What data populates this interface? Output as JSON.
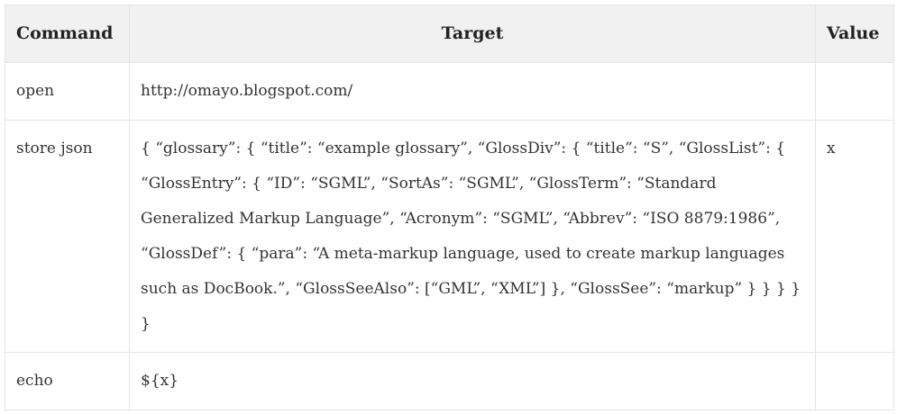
{
  "table": {
    "headers": [
      "Command",
      "Target",
      "Value"
    ],
    "rows": [
      {
        "command": "open",
        "target": "http://omayo.blogspot.com/",
        "value": ""
      },
      {
        "command": "store json",
        "target": "{ “glossary”: { “title”: “example glossary”, “GlossDiv”: { “title”: “S”, “GlossList”: { “GlossEntry”: { “ID”: “SGML”, “SortAs”: “SGML”, “GlossTerm”: “Standard Generalized Markup Language”, “Acronym”: “SGML”, “Abbrev”: “ISO 8879:1986”, “GlossDef”: { “para”: “A meta-markup language, used to create markup languages such as DocBook.”, “GlossSeeAlso”: [“GML”, “XML”] }, “GlossSee”: “markup” } } } } }",
        "value": "x"
      },
      {
        "command": "echo",
        "target": "${x}",
        "value": ""
      }
    ]
  }
}
